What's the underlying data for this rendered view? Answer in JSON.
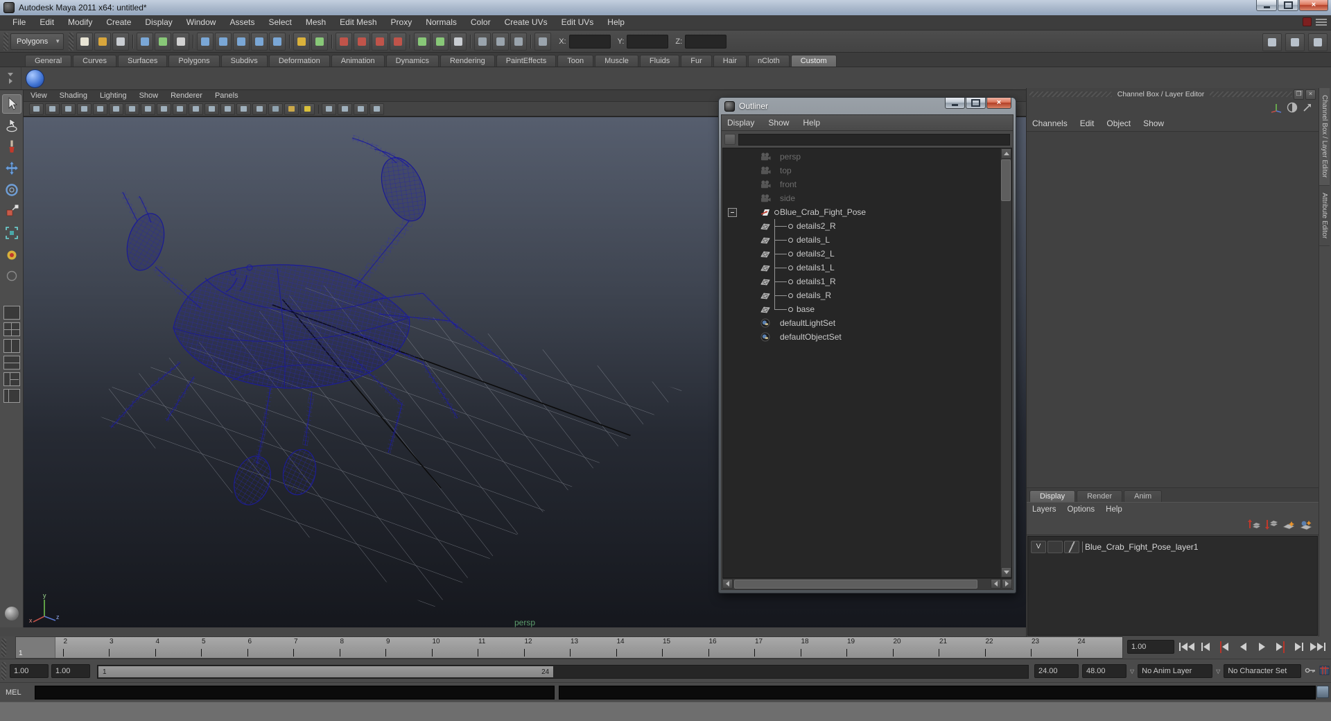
{
  "window": {
    "title": "Autodesk Maya 2011 x64: untitled*"
  },
  "menu_bar": {
    "items": [
      "File",
      "Edit",
      "Modify",
      "Create",
      "Display",
      "Window",
      "Assets",
      "Select",
      "Mesh",
      "Edit Mesh",
      "Proxy",
      "Normals",
      "Color",
      "Create UVs",
      "Edit UVs",
      "Help"
    ]
  },
  "status_line": {
    "menu_set": "Polygons",
    "coord_labels": {
      "x": "X:",
      "y": "Y:",
      "z": "Z:"
    },
    "coord_values": {
      "x": "",
      "y": "",
      "z": ""
    },
    "icons": [
      {
        "name": "new-scene-icon",
        "color": "#e8e4d4"
      },
      {
        "name": "open-scene-icon",
        "color": "#d8a63c"
      },
      {
        "name": "save-scene-icon",
        "color": "#c9cdd2"
      },
      {
        "name": "separator",
        "color": ""
      },
      {
        "name": "select-by-hierarchy-icon",
        "color": "#7aa7d6"
      },
      {
        "name": "select-by-object-icon",
        "color": "#88c878"
      },
      {
        "name": "select-by-component-icon",
        "color": "#d2d2d2"
      },
      {
        "name": "separator",
        "color": ""
      },
      {
        "name": "snap-to-grids-icon",
        "color": "#7aa7d6"
      },
      {
        "name": "snap-to-curves-icon",
        "color": "#7aa7d6"
      },
      {
        "name": "snap-to-points-icon",
        "color": "#7aa7d6"
      },
      {
        "name": "snap-to-view-planes-icon",
        "color": "#7aa7d6"
      },
      {
        "name": "make-live-icon",
        "color": "#7aa7d6"
      },
      {
        "name": "separator",
        "color": ""
      },
      {
        "name": "lock-selection-icon",
        "color": "#d9b13b"
      },
      {
        "name": "highlight-selection-icon",
        "color": "#88c878"
      },
      {
        "name": "separator",
        "color": ""
      },
      {
        "name": "snap-magnet-grid-icon",
        "color": "#c0544a"
      },
      {
        "name": "snap-magnet-curve-icon",
        "color": "#c0544a"
      },
      {
        "name": "snap-magnet-point-icon",
        "color": "#c0544a"
      },
      {
        "name": "snap-magnet-plane-icon",
        "color": "#c0544a"
      },
      {
        "name": "separator",
        "color": ""
      },
      {
        "name": "input-connections-icon",
        "color": "#88c878"
      },
      {
        "name": "output-connections-icon",
        "color": "#88c878"
      },
      {
        "name": "construction-history-icon",
        "color": "#c9cdd2"
      },
      {
        "name": "separator",
        "color": ""
      },
      {
        "name": "render-current-frame-icon",
        "color": "#9aa4ad"
      },
      {
        "name": "ipr-render-icon",
        "color": "#9aa4ad"
      },
      {
        "name": "render-settings-icon",
        "color": "#9aa4ad"
      },
      {
        "name": "separator",
        "color": ""
      },
      {
        "name": "quick-selection-dropdown-icon",
        "color": "#9aa4ad"
      }
    ],
    "right_icons": [
      {
        "name": "show-hide-channel-box-icon",
        "color": "#b9c2cc"
      },
      {
        "name": "show-hide-tool-settings-icon",
        "color": "#b9c2cc"
      },
      {
        "name": "show-hide-attribute-editor-icon",
        "color": "#b9c2cc"
      }
    ]
  },
  "shelf": {
    "tabs": [
      "General",
      "Curves",
      "Surfaces",
      "Polygons",
      "Subdivs",
      "Deformation",
      "Animation",
      "Dynamics",
      "Rendering",
      "PaintEffects",
      "Toon",
      "Muscle",
      "Fluids",
      "Fur",
      "Hair",
      "nCloth",
      "Custom"
    ],
    "active_tab": "Custom"
  },
  "toolbox": {
    "tools": [
      "select-tool",
      "lasso-select-tool",
      "paint-select-tool",
      "move-tool",
      "rotate-tool",
      "scale-tool",
      "universal-manipulator-tool",
      "soft-mod-tool",
      "last-tool-used"
    ],
    "layouts": [
      "single-pane-layout",
      "four-pane-layout",
      "two-pane-side-layout",
      "two-pane-stacked-layout",
      "three-pane-layout",
      "outliner-persp-layout"
    ]
  },
  "viewport": {
    "menus": [
      "View",
      "Shading",
      "Lighting",
      "Show",
      "Renderer",
      "Panels"
    ],
    "toolbar_icons": [
      {
        "name": "select-camera-icon",
        "color": "#9fb0bd"
      },
      {
        "name": "lock-camera-icon",
        "color": "#9fb0bd"
      },
      {
        "name": "camera-attributes-icon",
        "color": "#9fb0bd"
      },
      {
        "name": "bookmarks-icon",
        "color": "#9fb0bd"
      },
      {
        "name": "image-plane-icon",
        "color": "#9fb0bd"
      },
      {
        "name": "two-d-pan-zoom-icon",
        "color": "#9fb0bd"
      },
      {
        "name": "grease-pencil-icon",
        "color": "#9fb0bd"
      },
      {
        "name": "grid-toggle-icon",
        "color": "#9fb0bd"
      },
      {
        "name": "film-gate-icon",
        "color": "#9fb0bd"
      },
      {
        "name": "resolution-gate-icon",
        "color": "#9fb0bd"
      },
      {
        "name": "gate-mask-icon",
        "color": "#9fb0bd"
      },
      {
        "name": "field-chart-icon",
        "color": "#9fb0bd"
      },
      {
        "name": "safe-action-icon",
        "color": "#9fb0bd"
      },
      {
        "name": "safe-title-icon",
        "color": "#9fb0bd"
      },
      {
        "name": "wireframe-display-icon",
        "color": "#9fb0bd"
      },
      {
        "name": "shaded-display-icon",
        "color": "#8fa3b0"
      },
      {
        "name": "textured-display-icon",
        "color": "#caa84a"
      },
      {
        "name": "use-all-lights-icon",
        "color": "#d8c03b"
      },
      {
        "name": "separator",
        "color": ""
      },
      {
        "name": "shadows-icon",
        "color": "#9fb0bd"
      },
      {
        "name": "xray-icon",
        "color": "#9fb0bd"
      },
      {
        "name": "isolate-select-icon",
        "color": "#9fb0bd"
      },
      {
        "name": "multisample-icon",
        "color": "#9fb0bd"
      }
    ],
    "camera_label": "persp",
    "axis_labels": {
      "x": "x",
      "y": "y",
      "z": "z"
    }
  },
  "outliner": {
    "title": "Outliner",
    "menus": [
      "Display",
      "Show",
      "Help"
    ],
    "search_value": "",
    "items": [
      {
        "label": "persp",
        "type": "camera",
        "muted": true
      },
      {
        "label": "top",
        "type": "camera",
        "muted": true
      },
      {
        "label": "front",
        "type": "camera",
        "muted": true
      },
      {
        "label": "side",
        "type": "camera",
        "muted": true
      },
      {
        "label": "Blue_Crab_Fight_Pose",
        "type": "transform",
        "expanded": true
      },
      {
        "label": "details2_R",
        "type": "mesh",
        "child": true
      },
      {
        "label": "details_L",
        "type": "mesh",
        "child": true
      },
      {
        "label": "details2_L",
        "type": "mesh",
        "child": true
      },
      {
        "label": "details1_L",
        "type": "mesh",
        "child": true
      },
      {
        "label": "details1_R",
        "type": "mesh",
        "child": true
      },
      {
        "label": "details_R",
        "type": "mesh",
        "child": true
      },
      {
        "label": "base",
        "type": "mesh",
        "child": true
      },
      {
        "label": "defaultLightSet",
        "type": "set"
      },
      {
        "label": "defaultObjectSet",
        "type": "set"
      }
    ]
  },
  "channel_box": {
    "header": "Channel Box / Layer Editor",
    "menus": [
      "Channels",
      "Edit",
      "Object",
      "Show"
    ],
    "side_tabs": [
      "Channel Box / Layer Editor",
      "Attribute Editor"
    ]
  },
  "layer_editor": {
    "tabs": [
      "Display",
      "Render",
      "Anim"
    ],
    "active_tab": "Display",
    "menus": [
      "Layers",
      "Options",
      "Help"
    ],
    "layer": {
      "visibility": "V",
      "name": "Blue_Crab_Fight_Pose_layer1"
    }
  },
  "timeline": {
    "frames": [
      "1",
      "2",
      "3",
      "4",
      "5",
      "6",
      "7",
      "8",
      "9",
      "10",
      "11",
      "12",
      "13",
      "14",
      "15",
      "16",
      "17",
      "18",
      "19",
      "20",
      "21",
      "22",
      "23",
      "24"
    ],
    "current_frame": "1",
    "current_time": "1.00"
  },
  "range_slider": {
    "anim_start": "1.00",
    "play_start": "1.00",
    "bar_start": "1",
    "bar_end": "24",
    "play_end": "24.00",
    "anim_end": "48.00",
    "anim_layer": "No Anim Layer",
    "character_set": "No Character Set"
  },
  "command_line": {
    "label": "MEL",
    "input": "",
    "result": ""
  },
  "colors": {
    "crab_wireframe": "#2222a8",
    "viewport_label": "#5e9e6e",
    "snap_blue": "#7aa7d6",
    "magnet_red": "#c0544a",
    "titlebar_blue": "#a8b7ca"
  }
}
